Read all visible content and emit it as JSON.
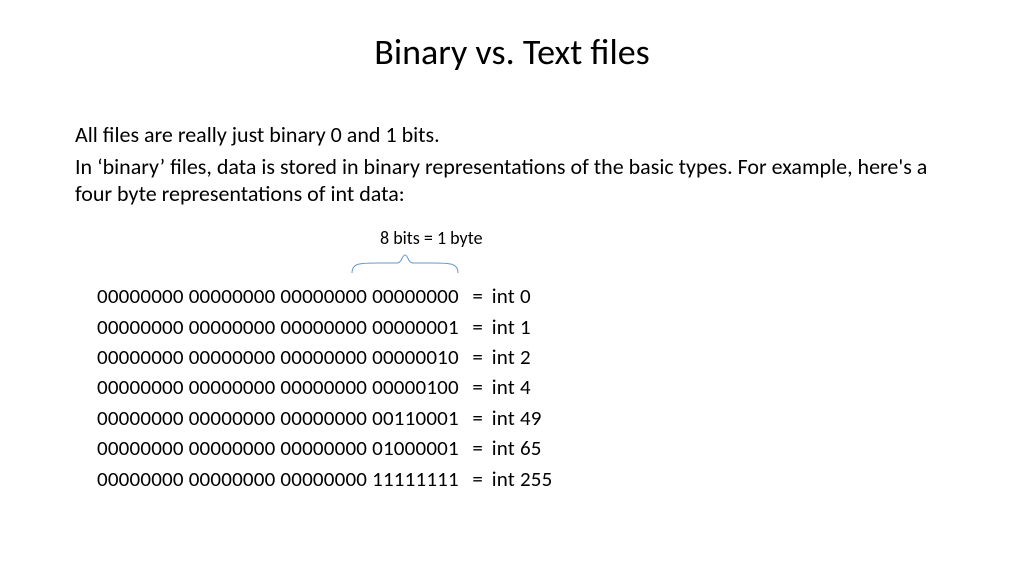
{
  "title": "Binary vs. Text files",
  "paragraphs": [
    "All files are really just binary 0 and 1 bits.",
    "In ‘binary’ files, data is stored in binary representations of the basic types. For example, here's a four byte representations of int data:"
  ],
  "annotation": "8 bits = 1 byte",
  "chart_data": {
    "type": "table",
    "columns": [
      "byte0",
      "byte1",
      "byte2",
      "byte3",
      "int_value"
    ],
    "rows": [
      {
        "byte0": "00000000",
        "byte1": "00000000",
        "byte2": "00000000",
        "byte3": "00000000",
        "int_value": 0
      },
      {
        "byte0": "00000000",
        "byte1": "00000000",
        "byte2": "00000000",
        "byte3": "00000001",
        "int_value": 1
      },
      {
        "byte0": "00000000",
        "byte1": "00000000",
        "byte2": "00000000",
        "byte3": "00000010",
        "int_value": 2
      },
      {
        "byte0": "00000000",
        "byte1": "00000000",
        "byte2": "00000000",
        "byte3": "00000100",
        "int_value": 4
      },
      {
        "byte0": "00000000",
        "byte1": "00000000",
        "byte2": "00000000",
        "byte3": "00110001",
        "int_value": 49
      },
      {
        "byte0": "00000000",
        "byte1": "00000000",
        "byte2": "00000000",
        "byte3": "01000001",
        "int_value": 65
      },
      {
        "byte0": "00000000",
        "byte1": "00000000",
        "byte2": "00000000",
        "byte3": "11111111",
        "int_value": 255
      }
    ]
  },
  "row_prefix": "int ",
  "eq": "="
}
